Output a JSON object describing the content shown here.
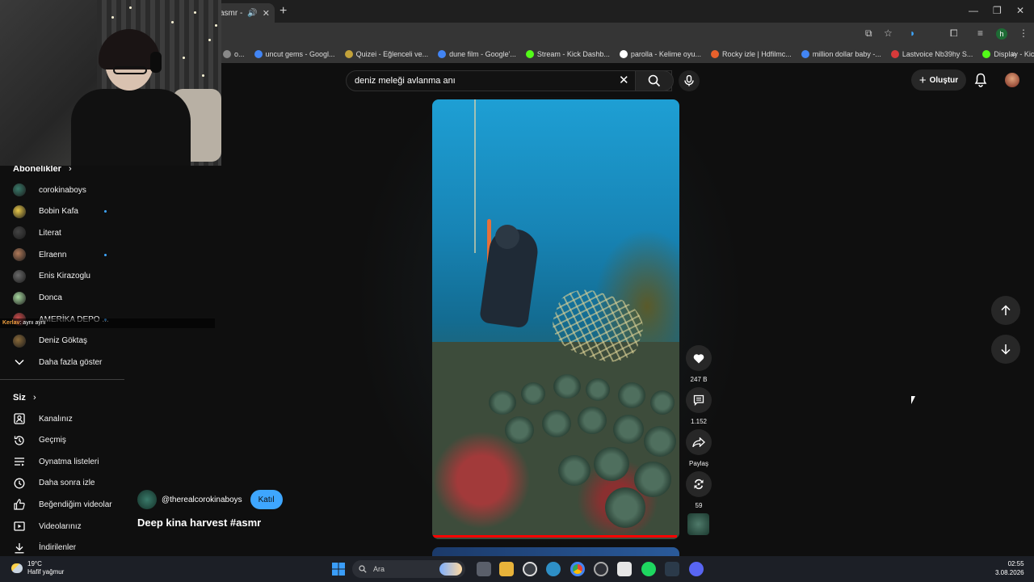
{
  "browser": {
    "tab_title": "asmr -",
    "new_tab": "+",
    "window_controls": [
      "—",
      "❐",
      "✕"
    ],
    "bookmarks": [
      {
        "label": "o...",
        "color": "#888888"
      },
      {
        "label": "uncut gems - Googl...",
        "color": "#4285f4"
      },
      {
        "label": "Quizei - Eğlenceli ve...",
        "color": "#c2a23a"
      },
      {
        "label": "dune film - Google'...",
        "color": "#4285f4"
      },
      {
        "label": "Stream - Kick Dashb...",
        "color": "#53fc18"
      },
      {
        "label": "parolla - Kelime oyu...",
        "color": "#ffffff"
      },
      {
        "label": "Rocky izle | Hdfilmc...",
        "color": "#e8612c"
      },
      {
        "label": "million dollar baby -...",
        "color": "#4285f4"
      },
      {
        "label": "Lastvoice Nb39hy S...",
        "color": "#d83a3a"
      },
      {
        "label": "Display - Kick Dash...",
        "color": "#53fc18"
      }
    ],
    "profile_initial": "h"
  },
  "youtube": {
    "search_value": "deniz meleği avlanma anı",
    "create_label": "Oluştur"
  },
  "sidebar": {
    "subscriptions_title": "Abonelikler",
    "subscriptions": [
      {
        "name": "corokinaboys",
        "color": "#3a7a6a",
        "live": false
      },
      {
        "name": "Bobin Kafa",
        "color": "#e8c84a",
        "live": true
      },
      {
        "name": "Literat",
        "color": "#444444",
        "live": false
      },
      {
        "name": "Elraenn",
        "color": "#b07a5a",
        "live": true
      },
      {
        "name": "Enis Kirazoglu",
        "color": "#6a6a6a",
        "live": false
      },
      {
        "name": "Donca",
        "color": "#a8d8a0",
        "live": false
      },
      {
        "name": "AMERİKA DEPO ...",
        "color": "#c84a4a",
        "live": true
      },
      {
        "name": "Deniz Göktaş",
        "color": "#8a6a3a",
        "live": false
      }
    ],
    "show_more": "Daha fazla göster",
    "you_title": "Siz",
    "you_items": [
      {
        "label": "Kanalınız",
        "icon": "channel-icon"
      },
      {
        "label": "Geçmiş",
        "icon": "history-icon"
      },
      {
        "label": "Oynatma listeleri",
        "icon": "playlists-icon"
      },
      {
        "label": "Daha sonra izle",
        "icon": "watch-later-icon"
      },
      {
        "label": "Beğendiğim videolar",
        "icon": "liked-icon"
      },
      {
        "label": "Videolarınız",
        "icon": "your-videos-icon"
      },
      {
        "label": "İndirilenler",
        "icon": "downloads-icon"
      }
    ]
  },
  "chat_overlay": {
    "user": "Kerlav",
    "message": ": aynı aynı"
  },
  "short": {
    "channel": "@therealcorokinaboys",
    "join_label": "Katıl",
    "title": "Deep kina harvest #asmr",
    "progress": 0.99,
    "likes": "247 B",
    "comments": "1.152",
    "share_label": "Paylaş",
    "remix_count": "59"
  },
  "taskbar": {
    "weather_temp": "19°C",
    "weather_desc": "Hafif yağmur",
    "search_placeholder": "Ara",
    "time": "02:55",
    "date": "3.08.2026"
  }
}
